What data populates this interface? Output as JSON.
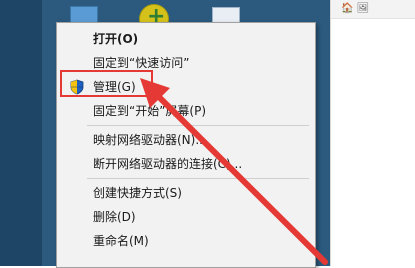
{
  "right_panel_text": "🏠 🖼",
  "context_menu": {
    "items": [
      {
        "label": "打开(O)",
        "bold": true
      },
      {
        "label": "固定到“快速访问”"
      },
      {
        "label": "管理(G)",
        "icon": "uac-shield-icon"
      },
      {
        "label": "固定到“开始”屏幕(P)"
      },
      {
        "label": "映射网络驱动器(N)..."
      },
      {
        "label": "断开网络驱动器的连接(C)..."
      },
      {
        "label": "创建快捷方式(S)"
      },
      {
        "label": "删除(D)"
      },
      {
        "label": "重命名(M)"
      }
    ]
  },
  "annotation": {
    "highlight_color": "#e53935",
    "arrow_color": "#e53935"
  }
}
